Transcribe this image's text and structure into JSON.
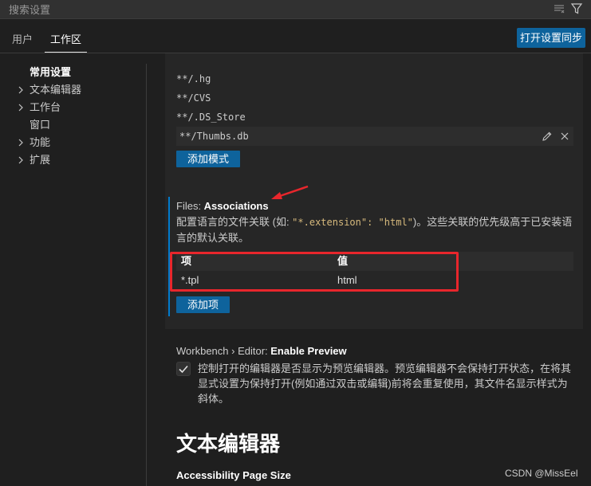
{
  "search": {
    "placeholder": "搜索设置"
  },
  "tabs": [
    {
      "label": "用户"
    },
    {
      "label": "工作区"
    }
  ],
  "sync_button": {
    "label": "打开设置同步"
  },
  "toc": [
    {
      "label": "常用设置"
    },
    {
      "label": "文本编辑器"
    },
    {
      "label": "工作台"
    },
    {
      "label": "窗口"
    },
    {
      "label": "功能"
    },
    {
      "label": "扩展"
    }
  ],
  "files_exclude": {
    "patterns": [
      "**/.hg",
      "**/CVS",
      "**/.DS_Store",
      "**/Thumbs.db"
    ],
    "add_button": "添加模式"
  },
  "associations": {
    "prefix": "Files: ",
    "title": "Associations",
    "desc_1": "配置语言的文件关联 (如: ",
    "desc_code": "\"*.extension\": \"html\"",
    "desc_2": ")。这些关联的优先级高于已安装语",
    "desc_3": "言的默认关联。",
    "col_key": "项",
    "col_value": "值",
    "row_key": "*.tpl",
    "row_value": "html",
    "add_button": "添加项"
  },
  "enable_preview": {
    "prefix": "Workbench › Editor: ",
    "title": "Enable Preview",
    "desc_1": "控制打开的编辑器是否显示为预览编辑器。预览编辑器不会保持打开状态，在将其",
    "desc_2": "显式设置为保持打开(例如通过双击或编辑)前将会重复使用，其文件名显示样式为",
    "desc_3": "斜体。",
    "checked": true
  },
  "section_heading": "文本编辑器",
  "accessibility": {
    "title": "Accessibility Page Size"
  },
  "watermark": "CSDN @MissEel",
  "colors": {
    "accent": "#0e639c",
    "highlight_box": "#e8262c",
    "focus_bar": "#007acc"
  }
}
